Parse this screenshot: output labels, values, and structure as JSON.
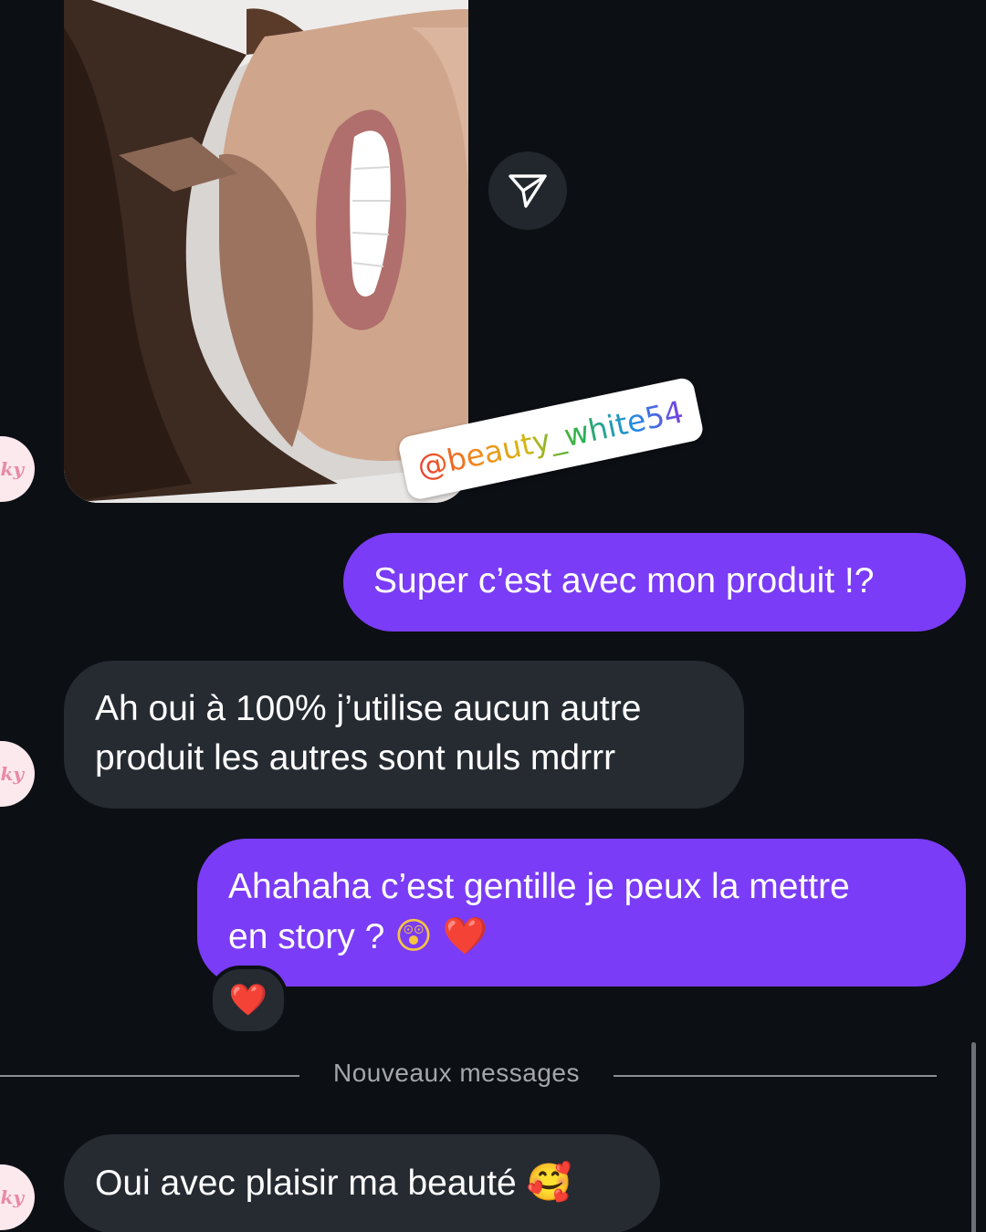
{
  "shared_post": {
    "mention": "@beauty_white54"
  },
  "avatar": {
    "label": "ky"
  },
  "messages": [
    {
      "direction": "outgoing",
      "text": "Super c’est avec mon produit !?"
    },
    {
      "direction": "incoming",
      "lines": [
        "Ah oui à 100% j’utilise aucun autre",
        "produit les autres sont nuls mdrrr"
      ]
    },
    {
      "direction": "outgoing",
      "line1": "Ahahaha c’est gentille je peux la mettre",
      "line2": "en story ?",
      "emoji1": "😲",
      "emoji2": "❤️",
      "reaction": "❤️"
    },
    {
      "direction": "incoming",
      "text": "Oui avec plaisir ma beauté",
      "emoji": "🥰"
    }
  ],
  "divider": {
    "label": "Nouveaux messages"
  },
  "colors": {
    "background": "#0c0f14",
    "incoming_bubble": "#262a31",
    "outgoing_bubble": "#7a3cf6",
    "heart": "#e8222e"
  },
  "icons": {
    "share": "paper-plane-icon",
    "reaction": "heart-icon"
  }
}
